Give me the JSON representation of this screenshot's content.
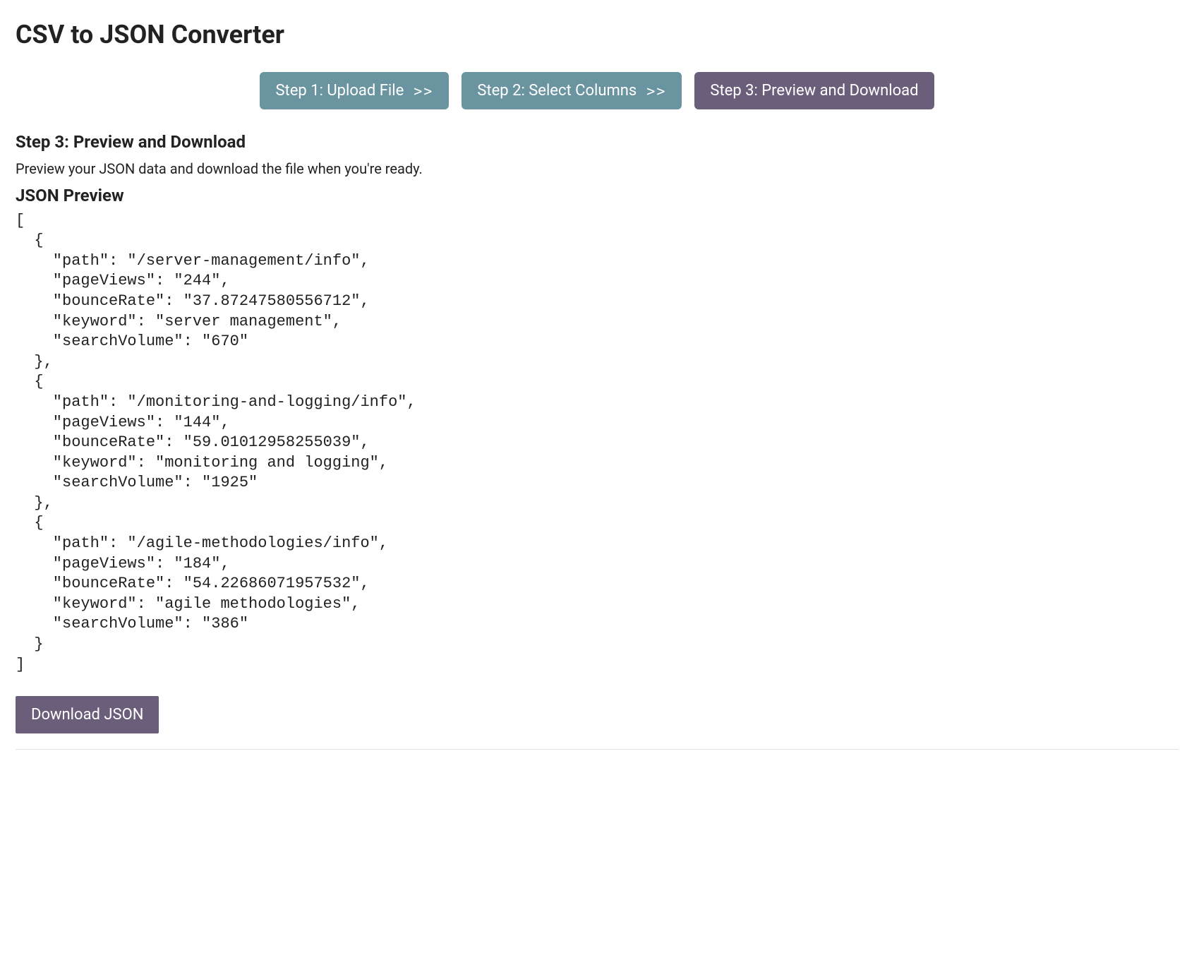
{
  "page": {
    "title": "CSV to JSON Converter"
  },
  "nav": {
    "steps": [
      {
        "label": "Step 1: Upload File",
        "chevrons": ">>",
        "active": false
      },
      {
        "label": "Step 2: Select Columns",
        "chevrons": ">>",
        "active": false
      },
      {
        "label": "Step 3: Preview and Download",
        "chevrons": "",
        "active": true
      }
    ]
  },
  "current_step": {
    "heading": "Step 3: Preview and Download",
    "description": "Preview your JSON data and download the file when you're ready.",
    "preview_heading": "JSON Preview",
    "json_preview_text": "[\n  {\n    \"path\": \"/server-management/info\",\n    \"pageViews\": \"244\",\n    \"bounceRate\": \"37.87247580556712\",\n    \"keyword\": \"server management\",\n    \"searchVolume\": \"670\"\n  },\n  {\n    \"path\": \"/monitoring-and-logging/info\",\n    \"pageViews\": \"144\",\n    \"bounceRate\": \"59.01012958255039\",\n    \"keyword\": \"monitoring and logging\",\n    \"searchVolume\": \"1925\"\n  },\n  {\n    \"path\": \"/agile-methodologies/info\",\n    \"pageViews\": \"184\",\n    \"bounceRate\": \"54.22686071957532\",\n    \"keyword\": \"agile methodologies\",\n    \"searchVolume\": \"386\"\n  }\n]",
    "json_preview_data": [
      {
        "path": "/server-management/info",
        "pageViews": "244",
        "bounceRate": "37.87247580556712",
        "keyword": "server management",
        "searchVolume": "670"
      },
      {
        "path": "/monitoring-and-logging/info",
        "pageViews": "144",
        "bounceRate": "59.01012958255039",
        "keyword": "monitoring and logging",
        "searchVolume": "1925"
      },
      {
        "path": "/agile-methodologies/info",
        "pageViews": "184",
        "bounceRate": "54.22686071957532",
        "keyword": "agile methodologies",
        "searchVolume": "386"
      }
    ],
    "download_label": "Download JSON"
  },
  "colors": {
    "step_inactive_bg": "#6a94a0",
    "step_active_bg": "#6b5e7b",
    "button_bg": "#6b5e7b"
  }
}
